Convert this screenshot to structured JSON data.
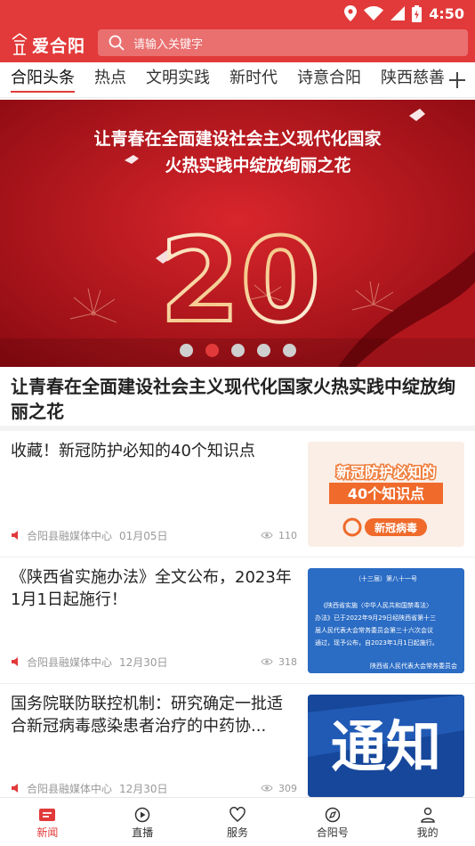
{
  "status_bar": {
    "time": "4:50"
  },
  "app": {
    "logo_text": "爱合阳"
  },
  "search": {
    "placeholder": "请输入关键字"
  },
  "channel_tabs": [
    {
      "label": "合阳头条",
      "active": true
    },
    {
      "label": "热点"
    },
    {
      "label": "文明实践"
    },
    {
      "label": "新时代"
    },
    {
      "label": "诗意合阳"
    },
    {
      "label": "陕西慈善"
    }
  ],
  "banner": {
    "line1": "让青春在全面建设社会主义现代化国家",
    "line2": "火热实践中绽放绚丽之花",
    "big_number": "20",
    "slide_count": 5,
    "active_index": 1,
    "headline": "让青春在全面建设社会主义现代化国家火热实践中绽放绚丽之花"
  },
  "news": [
    {
      "title": "收藏！新冠防护必知的40个知识点",
      "source": "合阳县融媒体中心",
      "date": "01月05日",
      "views": "110",
      "thumb": {
        "line1": "新冠防护必知的",
        "line2": "40个知识点",
        "tag": "新冠病毒"
      }
    },
    {
      "title": "《陕西省实施办法》全文公布，2023年1月1日起施行！",
      "source": "合阳县融媒体中心",
      "date": "12月30日",
      "views": "318",
      "thumb": {
        "header": "（十三届）第八十一号",
        "lines": [
          "《陕西省实施〈中华人民共和国禁毒法〉",
          "办法》已于2022年9月29日经陕西省第十三",
          "届人民代表大会常务委员会第三十六次会议",
          "通过，现予公布，自2023年1月1日起施行。"
        ],
        "footer": "陕西省人民代表大会常务委员会"
      }
    },
    {
      "title": "国务院联防联控机制：研究确定一批适合新冠病毒感染患者治疗的中药协...",
      "source": "合阳县融媒体中心",
      "date": "12月30日",
      "views": "309",
      "thumb": {
        "big": "通知"
      }
    }
  ],
  "bottom_nav": [
    {
      "label": "新闻",
      "icon": "news-icon",
      "active": true
    },
    {
      "label": "直播",
      "icon": "live-icon"
    },
    {
      "label": "服务",
      "icon": "service-icon"
    },
    {
      "label": "合阳号",
      "icon": "compass-icon"
    },
    {
      "label": "我的",
      "icon": "user-icon"
    }
  ],
  "colors": {
    "brand": "#e23a3a",
    "banner_bg": "#b3121a",
    "thumb_blue": "#1d5fb8"
  }
}
